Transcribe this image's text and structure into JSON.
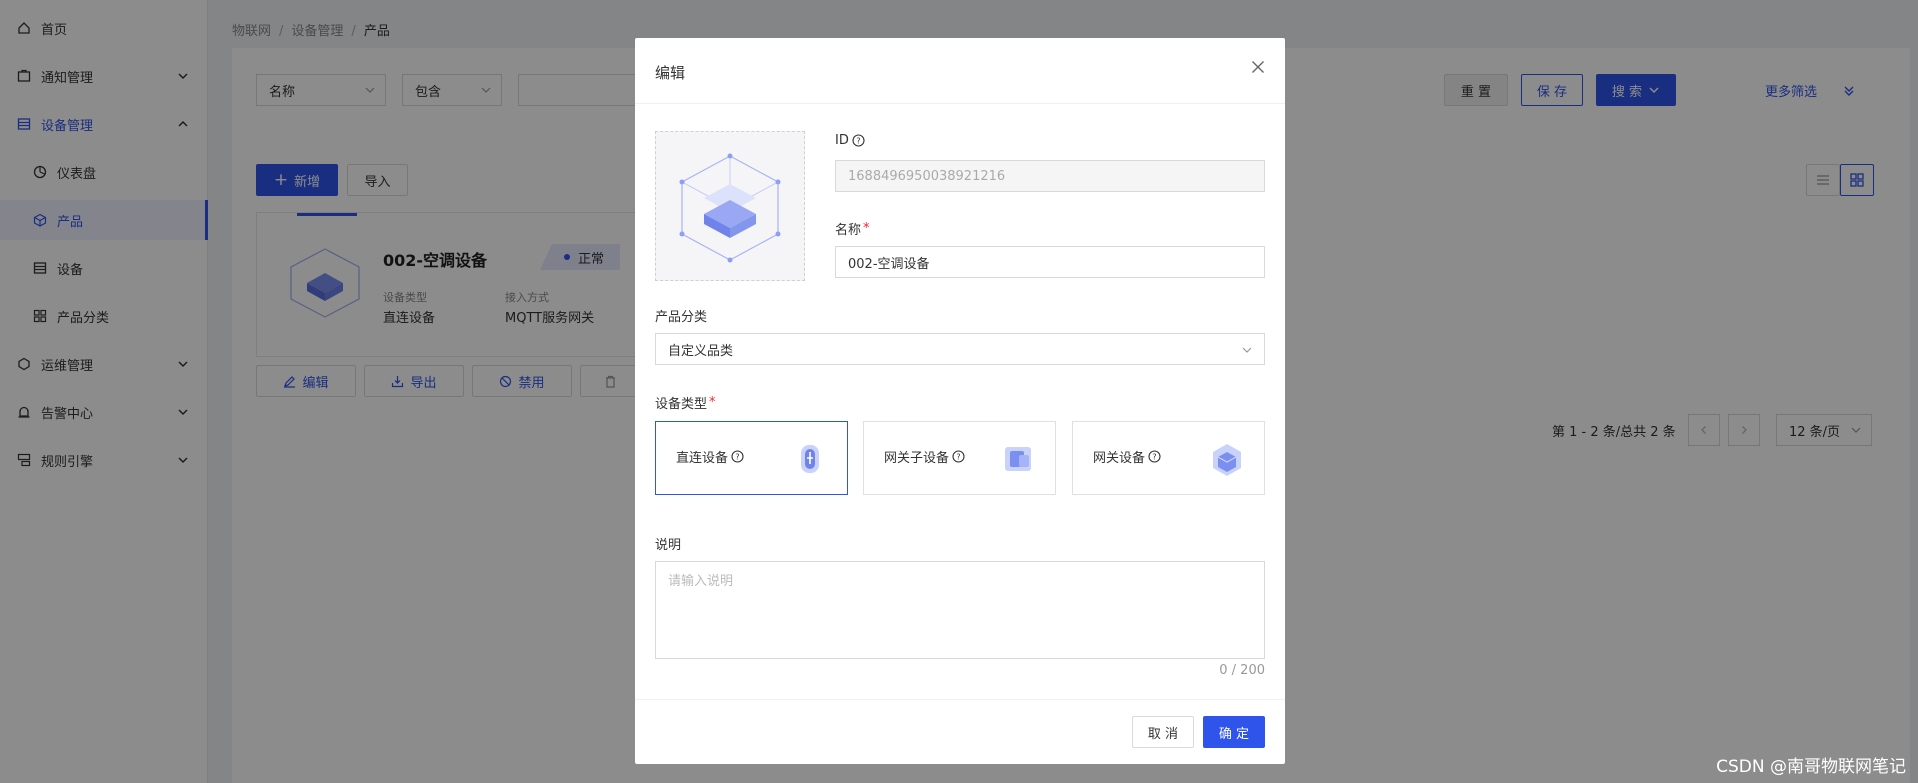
{
  "sidebar": {
    "items": [
      {
        "label": "首页",
        "icon": "home-icon"
      },
      {
        "label": "通知管理",
        "icon": "notification-icon"
      },
      {
        "label": "设备管理",
        "icon": "device-icon"
      },
      {
        "label": "仪表盘",
        "icon": "dashboard-icon"
      },
      {
        "label": "产品",
        "icon": "product-cube-icon"
      },
      {
        "label": "设备",
        "icon": "device-list-icon"
      },
      {
        "label": "产品分类",
        "icon": "category-icon"
      },
      {
        "label": "运维管理",
        "icon": "ops-icon"
      },
      {
        "label": "告警中心",
        "icon": "alarm-icon"
      },
      {
        "label": "规则引擎",
        "icon": "rule-icon"
      }
    ]
  },
  "breadcrumb": {
    "items": [
      "物联网",
      "设备管理",
      "产品"
    ]
  },
  "filter": {
    "field": "名称",
    "operator": "包含",
    "reset_label": "重 置",
    "save_label": "保 存",
    "search_label": "搜 索",
    "more_filter_label": "更多筛选"
  },
  "toolbar": {
    "add_label": "新增",
    "import_label": "导入"
  },
  "product_card": {
    "name": "002-空调设备",
    "status": "正常",
    "device_type_label": "设备类型",
    "device_type_value": "直连设备",
    "access_label": "接入方式",
    "access_value": "MQTT服务网关",
    "edit_label": "编辑",
    "export_label": "导出",
    "disable_label": "禁用"
  },
  "pagination": {
    "summary": "第 1 - 2 条/总共 2 条",
    "page_size": "12 条/页"
  },
  "modal": {
    "title": "编辑",
    "id_label": "ID",
    "id_value": "1688496950038921216",
    "name_label": "名称",
    "name_value": "002-空调设备",
    "category_label": "产品分类",
    "category_value": "自定义品类",
    "device_type_label": "设备类型",
    "device_types": [
      {
        "label": "直连设备",
        "selected": true
      },
      {
        "label": "网关子设备",
        "selected": false
      },
      {
        "label": "网关设备",
        "selected": false
      }
    ],
    "description_label": "说明",
    "description_placeholder": "请输入说明",
    "counter": "0 / 200",
    "cancel_label": "取 消",
    "ok_label": "确 定"
  },
  "watermark": "CSDN @南哥物联网笔记",
  "colors": {
    "primary": "#2f54eb",
    "required": "#f5222d"
  }
}
